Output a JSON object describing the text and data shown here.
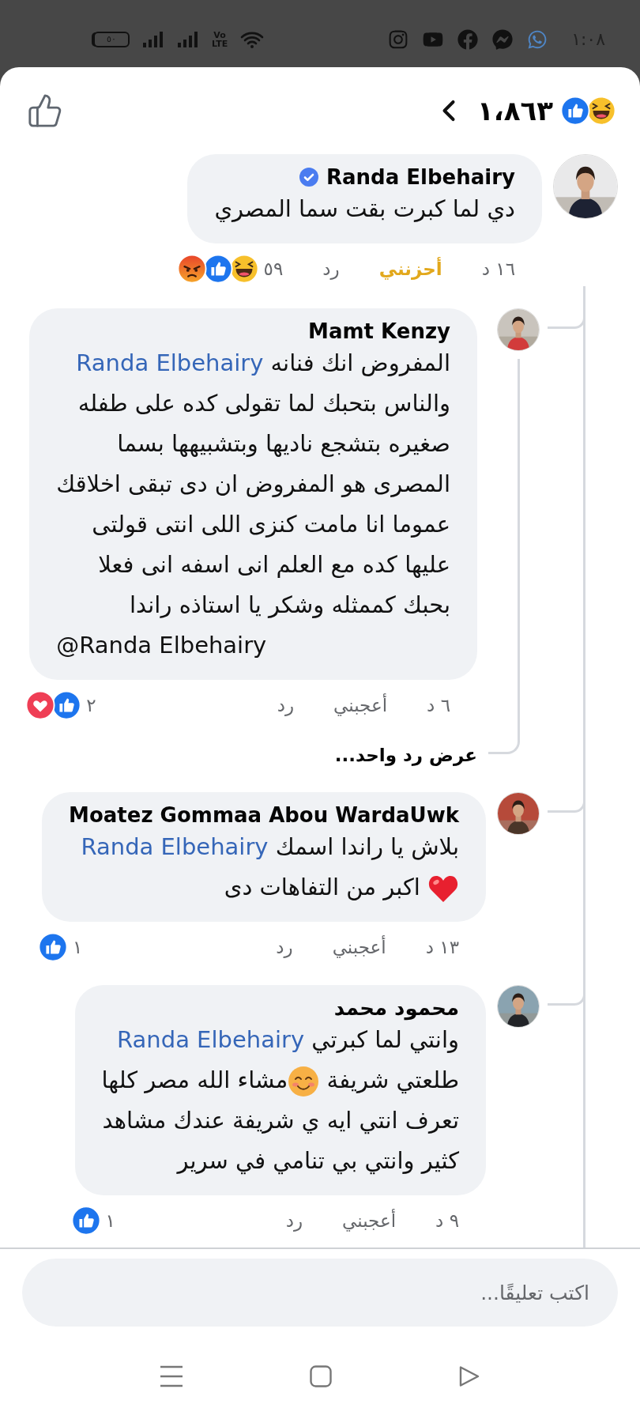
{
  "status_bar": {
    "time": "١:٠٨",
    "battery": "٥٠",
    "network": "Vo LTE"
  },
  "header": {
    "reactions": [
      {
        "kind": "laugh"
      },
      {
        "kind": "like"
      }
    ],
    "count": "١،٨٦٣"
  },
  "comments": [
    {
      "author": "Randa Elbehairy",
      "verified": true,
      "lines": [
        [
          {
            "kind": "text",
            "text": "دي لما كبرت بقت سما المصري"
          }
        ]
      ],
      "time": "١٦ د",
      "like_label": "أحزنني",
      "reacted": true,
      "reply_label": "رد",
      "reaction_count": "٥٩",
      "reactions": [
        {
          "kind": "laugh"
        },
        {
          "kind": "like"
        },
        {
          "kind": "angry"
        }
      ],
      "replies": [
        {
          "author": "Mamt Kenzy",
          "verified": false,
          "lines": [
            [
              {
                "kind": "text",
                "text": "المفروض انك فنانه "
              },
              {
                "kind": "mention",
                "text": "Randa Elbehairy"
              }
            ],
            [
              {
                "kind": "text",
                "text": "والناس بتحبك لما تقولى كده على طفله"
              }
            ],
            [
              {
                "kind": "text",
                "text": "صغيره بتشجع ناديها وبتشبيهها بسما"
              }
            ],
            [
              {
                "kind": "text",
                "text": "المصرى هو المفروض ان دى تبقى اخلاقك"
              }
            ],
            [
              {
                "kind": "text",
                "text": "عموما انا مامت كنزى اللى انتى قولتى"
              }
            ],
            [
              {
                "kind": "text",
                "text": "عليها كده مع العلم انى اسفه انى فعلا"
              }
            ],
            [
              {
                "kind": "text",
                "text": "بحبك كممثله وشكر يا استاذه راندا"
              }
            ],
            [
              {
                "kind": "text",
                "text": "@Randa Elbehairy"
              }
            ]
          ],
          "time": "٦ د",
          "like_label": "أعجبني",
          "reacted": false,
          "reply_label": "رد",
          "reaction_count": "٢",
          "reactions": [
            {
              "kind": "like"
            },
            {
              "kind": "love"
            }
          ],
          "more_replies": "عرض رد واحد..."
        },
        {
          "author": "Moatez Gommaa Abou WardaUwk",
          "verified": false,
          "lines": [
            [
              {
                "kind": "text",
                "text": "بلاش يا راندا اسمك "
              },
              {
                "kind": "mention",
                "text": "Randa Elbehairy"
              }
            ],
            [
              {
                "kind": "heart"
              },
              {
                "kind": "text",
                "text": " اكبر من التفاهات دى"
              }
            ]
          ],
          "time": "١٣ د",
          "like_label": "أعجبني",
          "reacted": false,
          "reply_label": "رد",
          "reaction_count": "١",
          "reactions": [
            {
              "kind": "like"
            }
          ]
        },
        {
          "author": "محمود محمد",
          "verified": false,
          "lines": [
            [
              {
                "kind": "text",
                "text": "وانتي لما كبرتي "
              },
              {
                "kind": "mention",
                "text": "Randa Elbehairy"
              }
            ],
            [
              {
                "kind": "text",
                "text": "طلعتي شريفة "
              },
              {
                "kind": "smile"
              },
              {
                "kind": "text",
                "text": "مشاء الله مصر كلها"
              }
            ],
            [
              {
                "kind": "text",
                "text": "تعرف انتي ايه ي شريفة عندك مشاهد"
              }
            ],
            [
              {
                "kind": "text",
                "text": "كثير وانتي بي تنامي في سرير"
              }
            ]
          ],
          "time": "٩ د",
          "like_label": "أعجبني",
          "reacted": false,
          "reply_label": "رد",
          "reaction_count": "١",
          "reactions": [
            {
              "kind": "like"
            }
          ]
        }
      ]
    }
  ],
  "comment_field": {
    "placeholder": "اكتب تعليقًا..."
  }
}
